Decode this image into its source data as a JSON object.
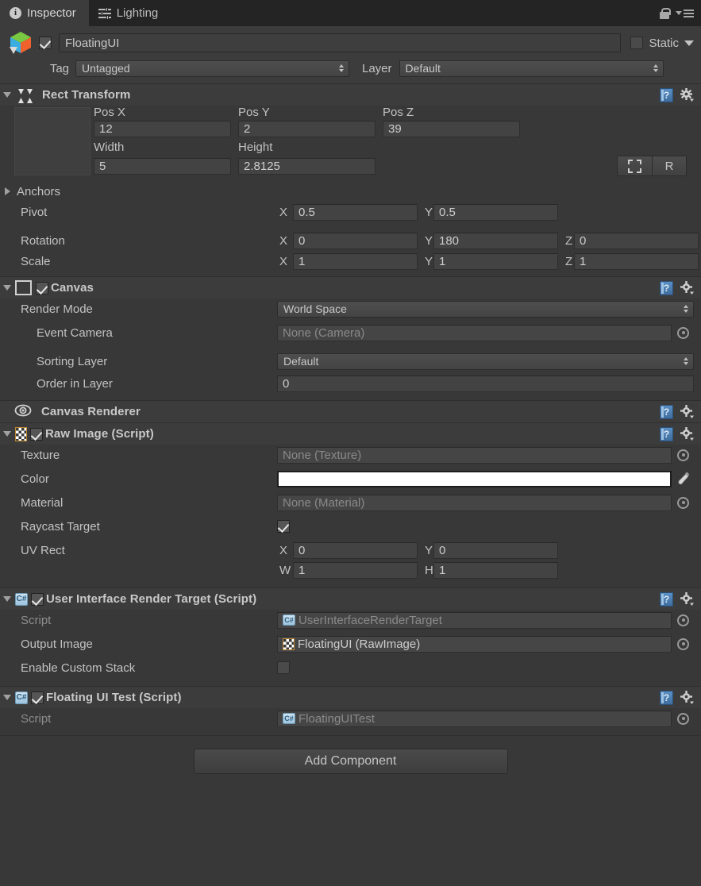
{
  "tabs": [
    {
      "label": "Inspector",
      "icon": "info-icon",
      "active": true
    },
    {
      "label": "Lighting",
      "icon": "lighting-icon",
      "active": false
    }
  ],
  "window_icons": {
    "lock": "lock-icon",
    "menu": "menu-icon"
  },
  "gameobject": {
    "icon": "prefab-cube-icon",
    "enabled": true,
    "name": "FloatingUI",
    "static_label": "Static",
    "static_checked": false,
    "tag_label": "Tag",
    "tag_value": "Untagged",
    "layer_label": "Layer",
    "layer_value": "Default"
  },
  "rect_transform": {
    "title": "Rect Transform",
    "expanded": true,
    "col_headers": {
      "pos_x": "Pos X",
      "pos_y": "Pos Y",
      "pos_z": "Pos Z",
      "width": "Width",
      "height": "Height"
    },
    "pos_x": "12",
    "pos_y": "2",
    "pos_z": "39",
    "width": "5",
    "height": "2.8125",
    "blueprint_button": "blueprint-icon",
    "raw_button": "R",
    "anchors_label": "Anchors",
    "anchors_expanded": false,
    "pivot_label": "Pivot",
    "pivot": {
      "x": "0.5",
      "y": "0.5"
    },
    "rotation_label": "Rotation",
    "rotation": {
      "x": "0",
      "y": "180",
      "z": "0"
    },
    "scale_label": "Scale",
    "scale": {
      "x": "1",
      "y": "1",
      "z": "1"
    },
    "axis": {
      "x": "X",
      "y": "Y",
      "z": "Z"
    }
  },
  "canvas": {
    "title": "Canvas",
    "enabled": true,
    "render_mode_label": "Render Mode",
    "render_mode_value": "World Space",
    "event_camera_label": "Event Camera",
    "event_camera_value": "None (Camera)",
    "sorting_layer_label": "Sorting Layer",
    "sorting_layer_value": "Default",
    "order_in_layer_label": "Order in Layer",
    "order_in_layer_value": "0"
  },
  "canvas_renderer": {
    "title": "Canvas Renderer",
    "icon": "eye-icon"
  },
  "raw_image": {
    "title": "Raw Image (Script)",
    "enabled": true,
    "icon": "checkerboard-icon",
    "texture_label": "Texture",
    "texture_value": "None (Texture)",
    "color_label": "Color",
    "color_value": "#FFFFFF",
    "material_label": "Material",
    "material_value": "None (Material)",
    "raycast_target_label": "Raycast Target",
    "raycast_target_checked": true,
    "uv_rect_label": "UV Rect",
    "uv_rect": {
      "x": "0",
      "y": "0",
      "w": "1",
      "h": "1"
    },
    "uv_prefix": {
      "x": "X",
      "y": "Y",
      "w": "W",
      "h": "H"
    }
  },
  "ui_render_target": {
    "title": "User Interface Render Target (Script)",
    "enabled": true,
    "icon": "csharp-script-icon",
    "script_label": "Script",
    "script_value": "UserInterfaceRenderTarget",
    "output_image_label": "Output Image",
    "output_image_value": "FloatingUI (RawImage)",
    "enable_custom_stack_label": "Enable Custom Stack",
    "enable_custom_stack_checked": false
  },
  "floating_ui_test": {
    "title": "Floating UI Test (Script)",
    "enabled": true,
    "icon": "csharp-script-icon",
    "script_label": "Script",
    "script_value": "FloatingUITest"
  },
  "add_component": {
    "label": "Add Component"
  },
  "colors": {
    "background": "#383838",
    "panel": "#3c3c3c",
    "tabbar": "#242424",
    "field": "#434343",
    "text": "#c2c2c2",
    "accent_blue": "#5a8fc4",
    "checker_border": "#c08a32"
  }
}
